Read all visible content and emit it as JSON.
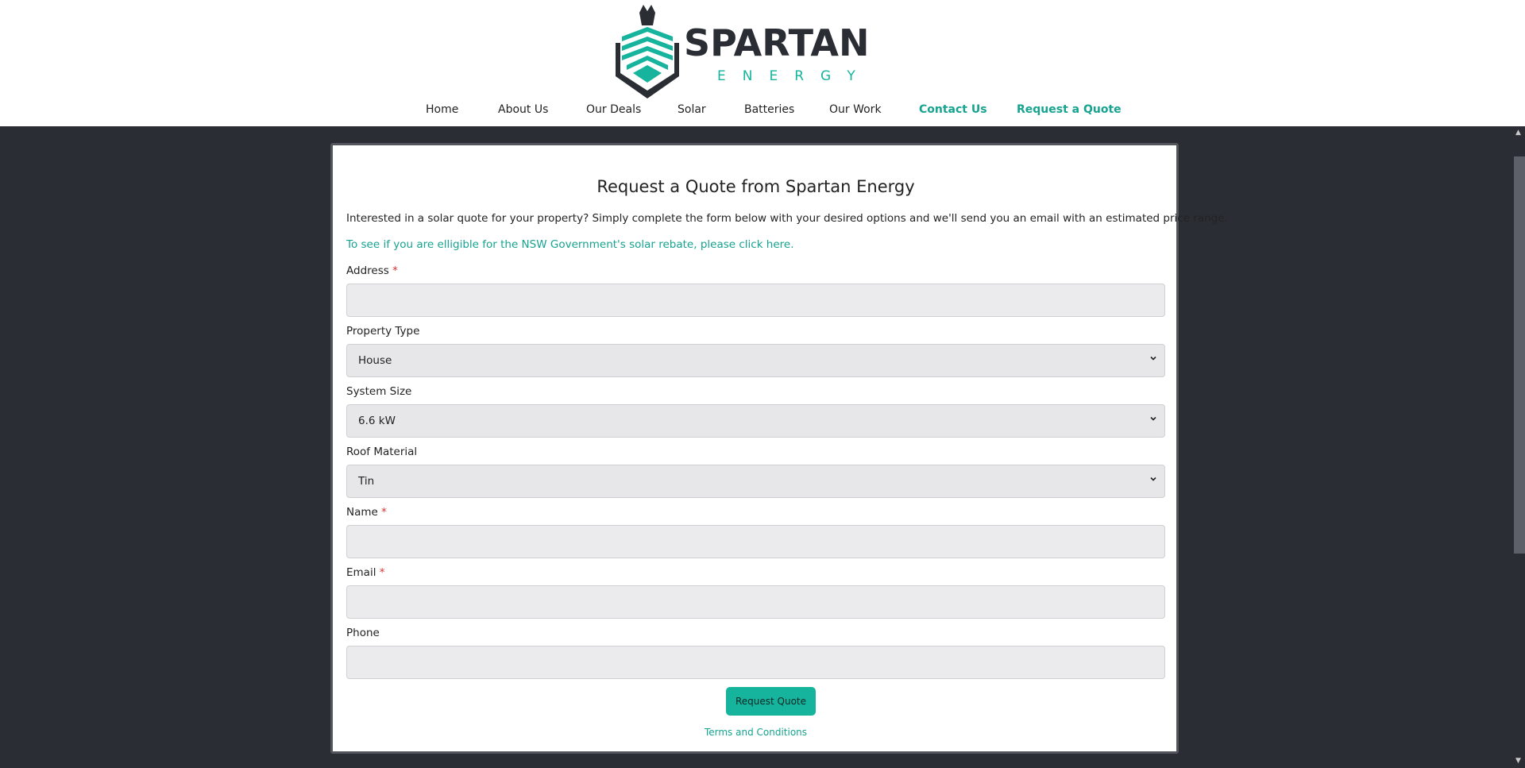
{
  "brand": {
    "name": "SPARTAN",
    "subtitle": "ENERGY",
    "accent_color": "#16b39d",
    "dark_color": "#2a2d34"
  },
  "nav": {
    "items": [
      {
        "label": "Home"
      },
      {
        "label": "About Us"
      },
      {
        "label": "Our Deals"
      },
      {
        "label": "Solar"
      },
      {
        "label": "Batteries"
      },
      {
        "label": "Our Work"
      },
      {
        "label": "Contact Us"
      },
      {
        "label": "Request a Quote"
      }
    ]
  },
  "form": {
    "title": "Request a Quote from Spartan Energy",
    "intro": "Interested in a solar quote for your property? Simply complete the form below with your desired options and we'll send you an email with an estimated price range.",
    "rebate_link": "To see if you are elligible for the NSW Government's solar rebate, please click here.",
    "fields": {
      "address": {
        "label": "Address",
        "required_mark": "*",
        "value": ""
      },
      "property_type": {
        "label": "Property Type",
        "value": "House"
      },
      "system_size": {
        "label": "System Size",
        "value": "6.6 kW"
      },
      "roof_material": {
        "label": "Roof Material",
        "value": "Tin"
      },
      "name": {
        "label": "Name",
        "required_mark": "*",
        "value": ""
      },
      "email": {
        "label": "Email",
        "required_mark": "*",
        "value": ""
      },
      "phone": {
        "label": "Phone",
        "value": ""
      }
    },
    "submit_label": "Request Quote",
    "terms_link": "Terms and Conditions"
  }
}
